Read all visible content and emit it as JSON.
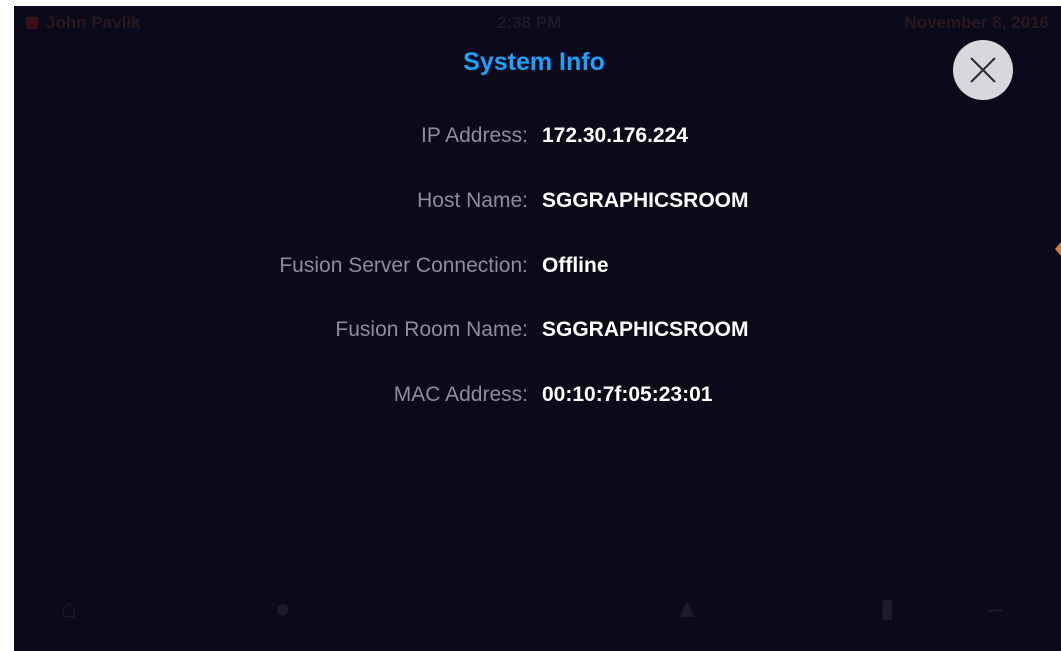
{
  "status_bar": {
    "user": "John Pavlik",
    "time": "2:38 PM",
    "date": "November 8, 2016"
  },
  "modal": {
    "title": "System Info",
    "close_icon": "close-x-icon",
    "rows": [
      {
        "label": "IP Address:",
        "value": "172.30.176.224"
      },
      {
        "label": "Host Name:",
        "value": "SGGRAPHICSROOM"
      },
      {
        "label": "Fusion Server Connection:",
        "value": "Offline"
      },
      {
        "label": "Fusion Room Name:",
        "value": "SGGRAPHICSROOM"
      },
      {
        "label": "MAC Address:",
        "value": "00:10:7f:05:23:01"
      }
    ]
  },
  "colors": {
    "background": "#0b0a1a",
    "title": "#1ba1ff",
    "label": "#8e8d99",
    "value": "#ffffff",
    "close_button": "#d8d8dc"
  }
}
